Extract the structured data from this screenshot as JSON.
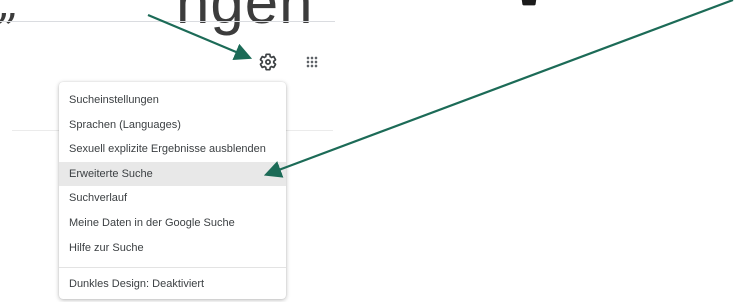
{
  "caption": {
    "quote_left": "„",
    "text": "...ngen",
    "quote_right": "\""
  },
  "header": {
    "settings_icon": "gear-icon",
    "apps_icon": "apps-grid-icon"
  },
  "menu": {
    "items": [
      {
        "label": "Sucheinstellungen"
      },
      {
        "label": "Sprachen  (Languages)"
      },
      {
        "label": "Sexuell explizite Ergebnisse ausblenden"
      },
      {
        "label": "Erweiterte Suche",
        "highlighted": true
      },
      {
        "label": "Suchverlauf"
      },
      {
        "label": "Meine Daten in der Google Suche"
      },
      {
        "label": "Hilfe zur Suche"
      }
    ],
    "footer_item": {
      "label": "Dunkles Design: Deaktiviert"
    }
  },
  "colors": {
    "arrow": "#1c6b57",
    "highlight": "#e8e8e8",
    "text": "#3c4043",
    "icon": "#5f6368"
  }
}
